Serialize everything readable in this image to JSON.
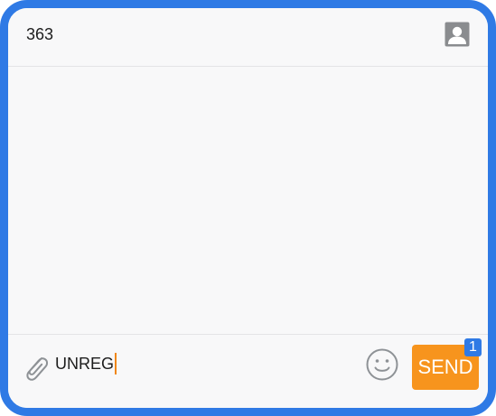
{
  "header": {
    "recipient": "363",
    "contact_icon": "contact-person-icon"
  },
  "composer": {
    "attach_icon": "paperclip-icon",
    "message_value": "UNREG",
    "emoji_icon": "smiley-icon",
    "send_label": "SEND",
    "send_badge": "1"
  },
  "colors": {
    "frame_border": "#2f7ae5",
    "background": "#f8f8f9",
    "send_button": "#f7941d",
    "badge": "#2f7ae5",
    "caret": "#f0871a"
  }
}
